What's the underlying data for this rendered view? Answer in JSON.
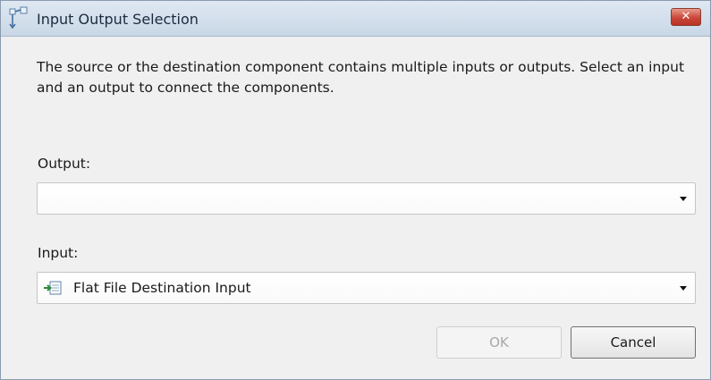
{
  "window": {
    "title": "Input Output Selection",
    "close_label": "✕"
  },
  "description": "The source or the destination component contains multiple inputs or outputs. Select an input and an output to connect the components.",
  "output": {
    "label": "Output:",
    "value": ""
  },
  "input": {
    "label": "Input:",
    "value": "Flat File Destination Input",
    "icon": "flat-file-destination-icon"
  },
  "buttons": {
    "ok_label": "OK",
    "ok_enabled": false,
    "cancel_label": "Cancel"
  }
}
